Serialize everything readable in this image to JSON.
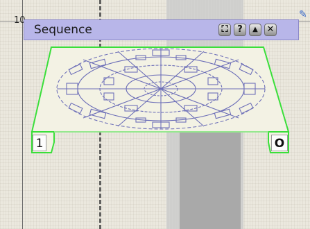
{
  "ruler": {
    "number": "10"
  },
  "panel": {
    "title": "Sequence",
    "buttons": [
      {
        "name": "expand-icon",
        "glyph": "⛶"
      },
      {
        "name": "help-icon",
        "glyph": "?"
      },
      {
        "name": "collapse-icon",
        "glyph": "▲"
      },
      {
        "name": "close-icon",
        "glyph": "✕"
      }
    ]
  },
  "card": {
    "start_label": "1",
    "end_label": "O",
    "outline_color": "#3adf3a",
    "pattern_color": "#6d6fb8"
  },
  "colors": {
    "panel": "#b8b6e9",
    "canvas": "#ebe8de",
    "band": "#cfcfcd"
  }
}
